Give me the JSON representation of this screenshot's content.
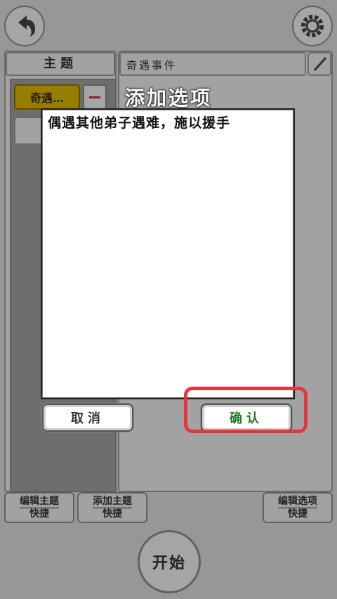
{
  "header": {
    "back_icon": "back-arrow-icon",
    "settings_icon": "gear-icon"
  },
  "left_panel": {
    "title": "主题",
    "selected_item": "奇遇…",
    "remove_icon": "minus-icon"
  },
  "right_panel": {
    "title": "奇遇事件",
    "edit_icon": "pencil-icon"
  },
  "bottom_bar": {
    "edit_theme": [
      "编辑主题",
      "快捷"
    ],
    "add_theme": [
      "添加主题",
      "快捷"
    ],
    "edit_option": [
      "编辑选项",
      "快捷"
    ],
    "start": "开始"
  },
  "dialog": {
    "title": "添加选项",
    "text_value": "偶遇其他弟子遇难，施以援手",
    "cancel_label": "取消",
    "confirm_label": "确认"
  },
  "colors": {
    "accent_gold": "#d9b400",
    "confirm_text": "#1e7a1e",
    "highlight": "#e8353d"
  }
}
